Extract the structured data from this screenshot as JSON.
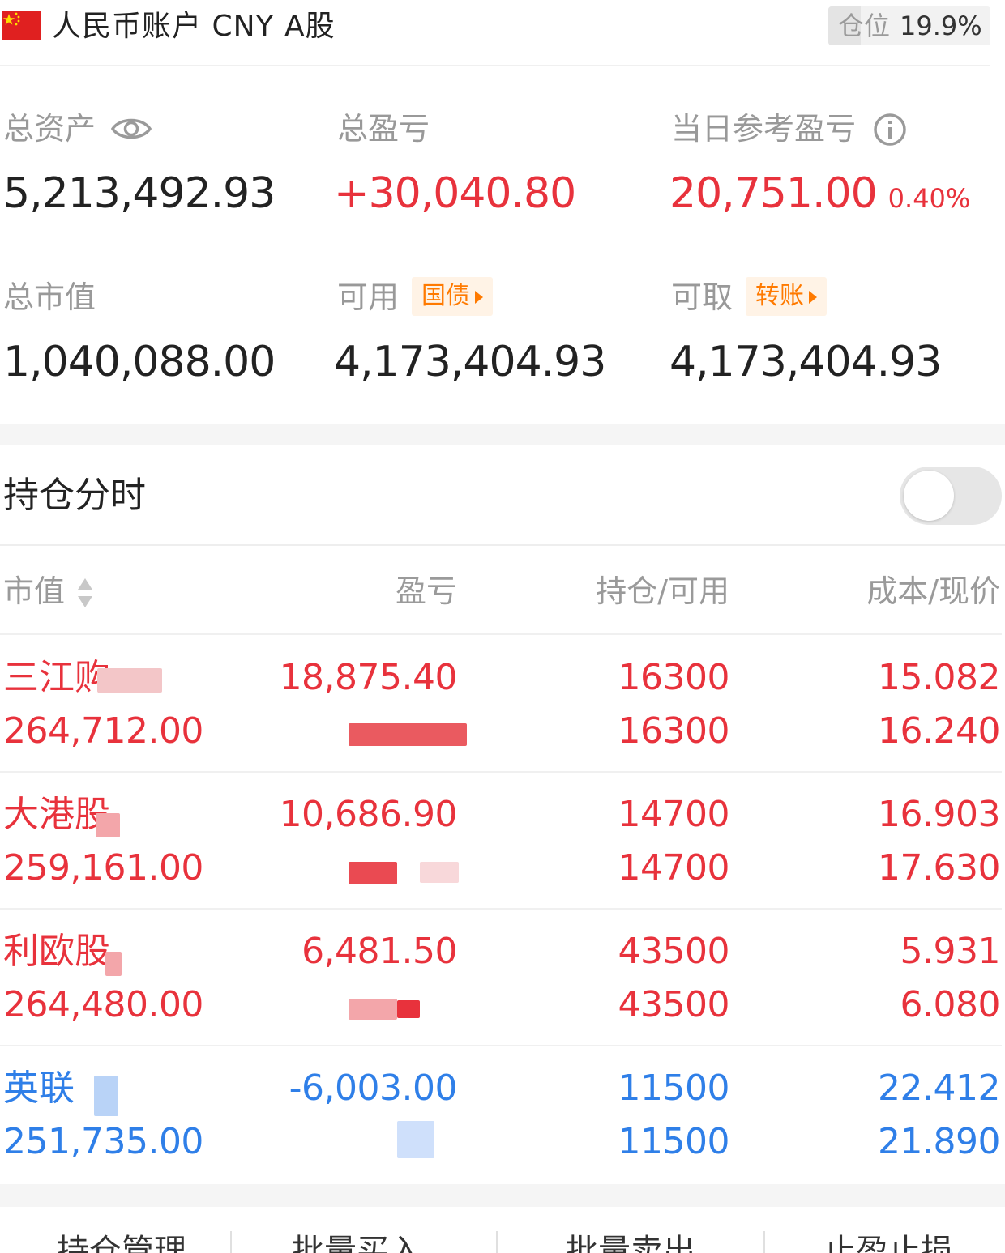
{
  "header": {
    "account_title": "人民币账户 CNY A股",
    "position_label": "仓位",
    "position_value": "19.9%",
    "position_ratio": 0.199
  },
  "summary": {
    "total_assets_label": "总资产",
    "total_assets_value": "5,213,492.93",
    "total_pl_label": "总盈亏",
    "total_pl_value": "+30,040.80",
    "daily_pl_label": "当日参考盈亏",
    "daily_pl_value": "20,751.00",
    "daily_pl_pct": "0.40%",
    "market_value_label": "总市值",
    "market_value_value": "1,040,088.00",
    "available_label": "可用",
    "available_tag": "国债",
    "available_value": "4,173,404.93",
    "withdrawable_label": "可取",
    "withdrawable_tag": "转账",
    "withdrawable_value": "4,173,404.93"
  },
  "holdings_section": {
    "title": "持仓分时",
    "toggle_on": false
  },
  "table": {
    "headers": {
      "market_value": "市值",
      "pl": "盈亏",
      "position": "持仓/可用",
      "cost": "成本/现价"
    },
    "rows": [
      {
        "name": "三江购",
        "market_value": "264,712.00",
        "pl": "18,875.40",
        "pl_pct": "",
        "position": "16300",
        "available": "16300",
        "cost": "15.082",
        "price": "16.240",
        "color": "#e8323c"
      },
      {
        "name": "大港股",
        "market_value": "259,161.00",
        "pl": "10,686.90",
        "pl_pct": "",
        "position": "14700",
        "available": "14700",
        "cost": "16.903",
        "price": "17.630",
        "color": "#e8323c"
      },
      {
        "name": "利欧股",
        "market_value": "264,480.00",
        "pl": "6,481.50",
        "pl_pct": "",
        "position": "43500",
        "available": "43500",
        "cost": "5.931",
        "price": "6.080",
        "color": "#e8323c"
      },
      {
        "name": "英联",
        "market_value": "251,735.00",
        "pl": "-6,003.00",
        "pl_pct": "",
        "position": "11500",
        "available": "11500",
        "cost": "22.412",
        "price": "21.890",
        "color": "#2f7fe8"
      }
    ]
  },
  "toolbar": {
    "items": [
      "持仓管理",
      "批量买入",
      "批量卖出",
      "止盈止损"
    ]
  },
  "colors": {
    "up": "#e8323c",
    "down": "#2f7fe8",
    "tag_bg": "#fff3e6",
    "tag_fg": "#ff7a00"
  }
}
